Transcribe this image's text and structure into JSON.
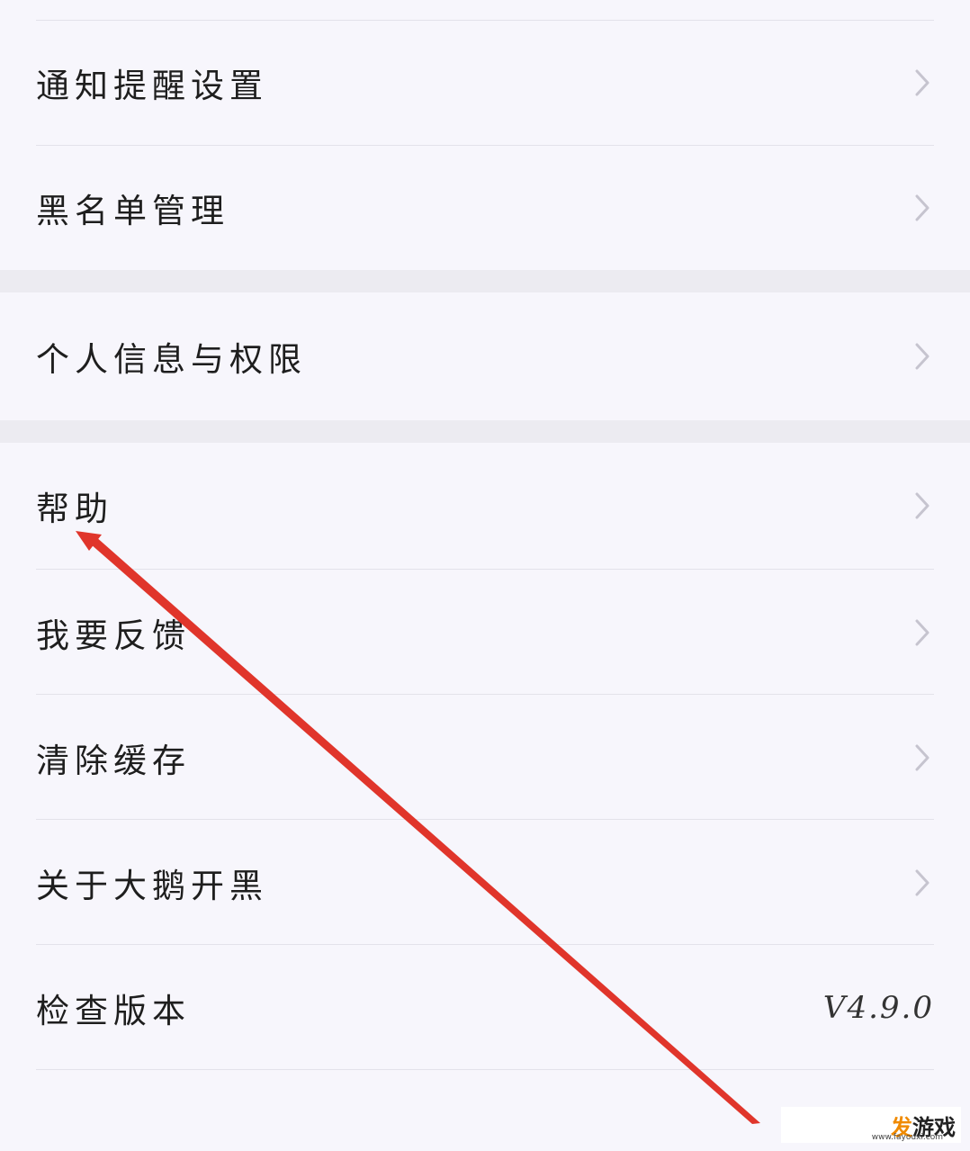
{
  "settings": {
    "items": [
      {
        "label": "通知提醒设置"
      },
      {
        "label": "黑名单管理"
      },
      {
        "label": "个人信息与权限"
      },
      {
        "label": "帮助"
      },
      {
        "label": "我要反馈"
      },
      {
        "label": "清除缓存"
      },
      {
        "label": "关于大鹅开黑"
      },
      {
        "label": "检查版本",
        "value": "V4.9.0"
      }
    ]
  },
  "watermark": {
    "logo_first": "发",
    "logo_rest": "游戏",
    "url": "www.fayouxi.com"
  },
  "colors": {
    "background": "#f7f6fc",
    "section_gap": "#ecebf1",
    "annotation_arrow": "#e0352b",
    "chevron": "#c6c4cf"
  }
}
